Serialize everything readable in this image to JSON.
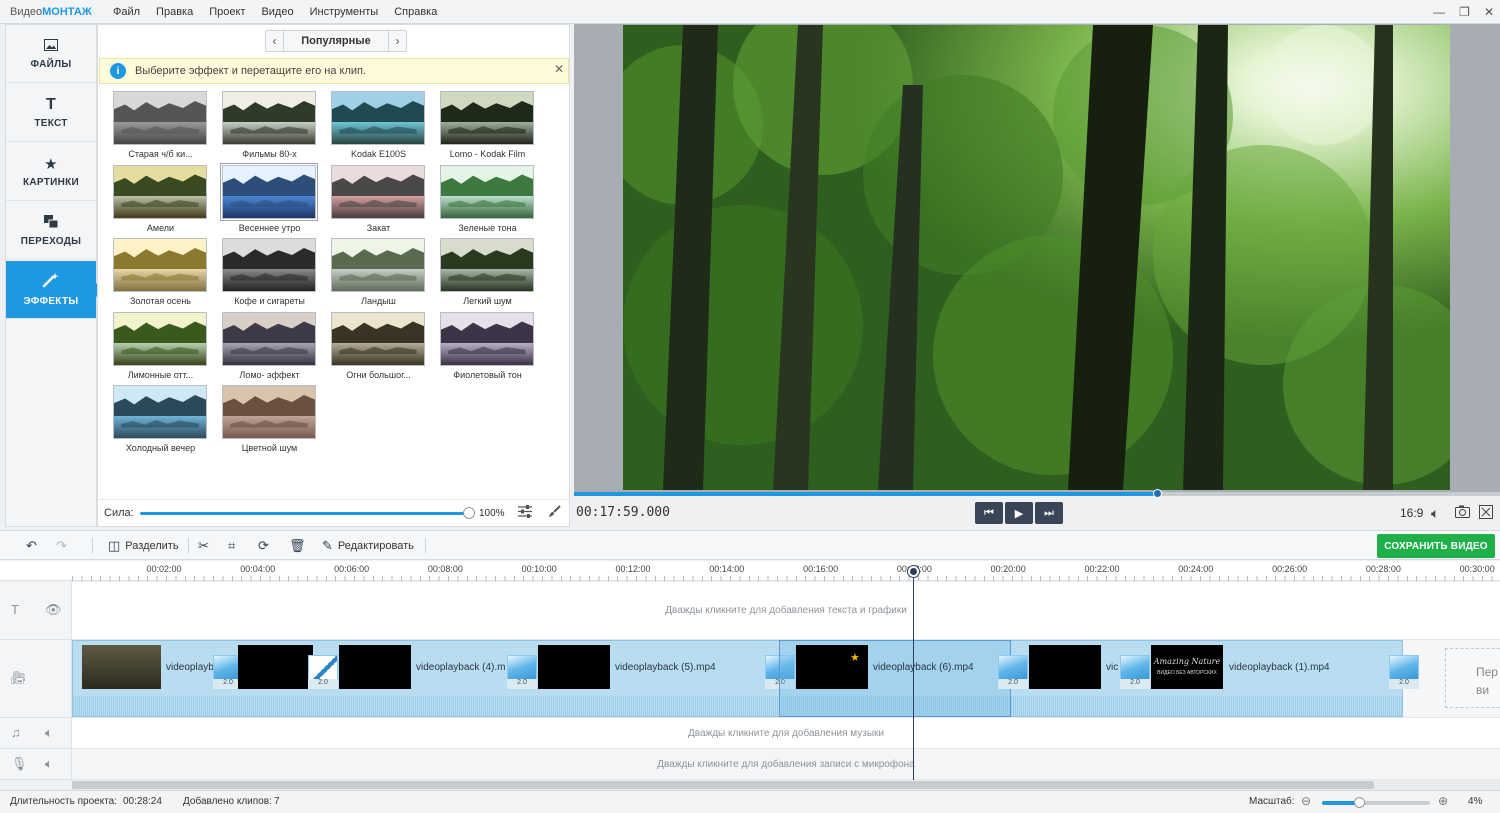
{
  "app": {
    "title_prefix": "Видео",
    "title_accent": "МОНТАЖ"
  },
  "menu": [
    "Файл",
    "Правка",
    "Проект",
    "Видео",
    "Инструменты",
    "Справка"
  ],
  "sidebar": {
    "items": [
      {
        "label": "ФАЙЛЫ",
        "icon": "image-icon",
        "active": false
      },
      {
        "label": "ТЕКСТ",
        "icon": "text-icon",
        "active": false
      },
      {
        "label": "КАРТИНКИ",
        "icon": "star-icon",
        "active": false
      },
      {
        "label": "ПЕРЕХОДЫ",
        "icon": "transitions-icon",
        "active": false
      },
      {
        "label": "ЭФФЕКТЫ",
        "icon": "magic-wand-icon",
        "active": true
      }
    ]
  },
  "effects_panel": {
    "category": "Популярные",
    "hint": "Выберите эффект и перетащите его на клип.",
    "effects": [
      {
        "label": "Старая ч/б ки...",
        "tone": "bw"
      },
      {
        "label": "Фильмы 80-х",
        "tone": "film80"
      },
      {
        "label": "Kodak E100S",
        "tone": "kodak"
      },
      {
        "label": "Lomo - Kodak Film",
        "tone": "lomo"
      },
      {
        "label": "Амели",
        "tone": "ameli"
      },
      {
        "label": "Весеннее утро",
        "tone": "spring"
      },
      {
        "label": "Закат",
        "tone": "sunset"
      },
      {
        "label": "Зеленые тона",
        "tone": "green"
      },
      {
        "label": "Золотая осень",
        "tone": "gold"
      },
      {
        "label": "Кофе и сигареты",
        "tone": "coffee"
      },
      {
        "label": "Ландыш",
        "tone": "lily"
      },
      {
        "label": "Легкий шум",
        "tone": "noise"
      },
      {
        "label": "Лимонные отт...",
        "tone": "lemon"
      },
      {
        "label": "Ломо- эффект",
        "tone": "lomo2"
      },
      {
        "label": "Огни большог...",
        "tone": "city"
      },
      {
        "label": "Фиолетовый тон",
        "tone": "violet"
      },
      {
        "label": "Холодный вечер",
        "tone": "cold"
      },
      {
        "label": "Цветной шум",
        "tone": "colornoise"
      }
    ],
    "selected_effect": "Весеннее утро",
    "strength_label": "Сила:",
    "strength_value": "100%",
    "strength_fraction": 1.0
  },
  "preview": {
    "timecode": "00:17:59.000",
    "aspect": "16:9",
    "progress_fraction": 0.631
  },
  "toolbar": {
    "split_label": "Разделить",
    "edit_label": "Редактировать",
    "save_label": "СОХРАНИТЬ ВИДЕО"
  },
  "timeline": {
    "ruler_labels": [
      "00:02:00",
      "00:04:00",
      "00:06:00",
      "00:08:00",
      "00:10:00",
      "00:12:00",
      "00:14:00",
      "00:16:00",
      "00:18:00",
      "00:20:00",
      "00:22:00",
      "00:24:00",
      "00:26:00",
      "00:28:00",
      "00:30:00"
    ],
    "text_hint": "Дважды кликните для добавления текста и графики",
    "music_hint": "Дважды кликните для добавления музыки",
    "mic_hint": "Дважды кликните для добавления записи с микрофона",
    "clips": [
      "videoplayb",
      "videoplayback (4).m",
      "videoplayback (5).mp4",
      "videoplayback (6).mp4",
      "vic",
      "videoplayback (1).mp4"
    ],
    "transition_value": "2.0",
    "thumb_caption_1": "Amazing Nature",
    "thumb_caption_2": "ВИДЕО БЕЗ АВТОРСКИХ",
    "empty_slot_text": "Пер ви"
  },
  "status": {
    "duration_label": "Длительность проекта:",
    "duration_value": "00:28:24",
    "clips_label": "Добавлено клипов:",
    "clips_value": "7",
    "zoom_label": "Масштаб:",
    "zoom_value": "4%"
  },
  "colors": {
    "accent": "#1e98e0",
    "save": "#1fb04a"
  }
}
